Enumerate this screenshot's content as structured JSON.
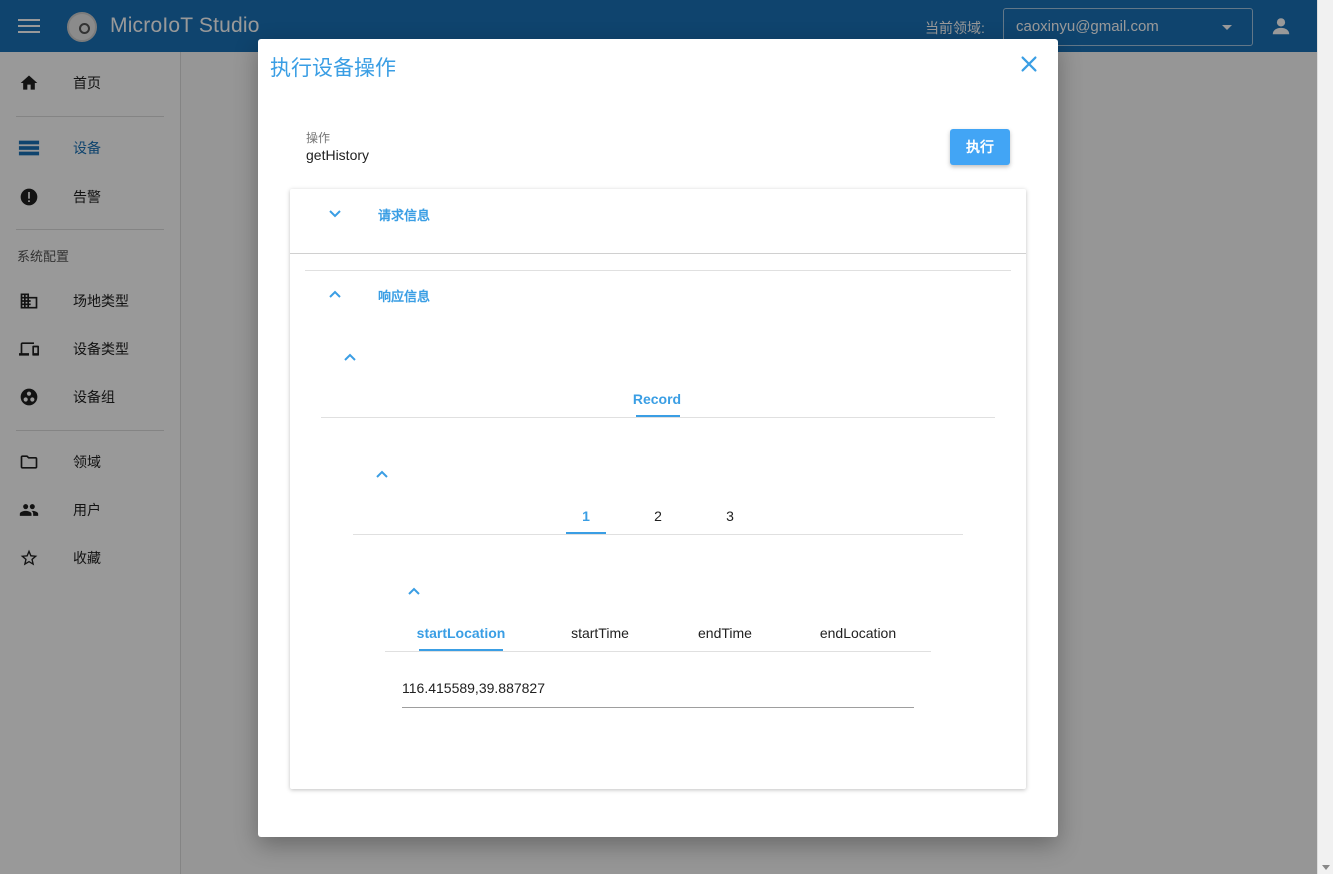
{
  "app": {
    "title": "MicroIoT Studio",
    "domain_label": "当前领域:",
    "domain_value": "caoxinyu@gmail.com"
  },
  "sidebar": {
    "items": [
      {
        "label": "首页",
        "icon": "home-icon"
      },
      {
        "label": "设备",
        "icon": "devices-icon",
        "active": true
      },
      {
        "label": "告警",
        "icon": "alert-icon"
      },
      {
        "label": "场地类型",
        "icon": "building-icon"
      },
      {
        "label": "设备类型",
        "icon": "device-type-icon"
      },
      {
        "label": "设备组",
        "icon": "group-icon"
      },
      {
        "label": "领域",
        "icon": "folder-icon"
      },
      {
        "label": "用户",
        "icon": "users-icon"
      },
      {
        "label": "收藏",
        "icon": "star-icon"
      }
    ],
    "section_title": "系统配置"
  },
  "dialog": {
    "title": "执行设备操作",
    "field_label": "操作",
    "field_value": "getHistory",
    "execute_label": "执行",
    "request_header": "请求信息",
    "response_header": "响应信息",
    "record_tab": "Record",
    "index_tabs": [
      "1",
      "2",
      "3"
    ],
    "field_tabs": [
      "startLocation",
      "startTime",
      "endTime",
      "endLocation"
    ],
    "value": "116.415589,39.887827"
  },
  "colors": {
    "appbar": "#1a72b8",
    "accent": "#3a9ee4",
    "button": "#42a5f5"
  }
}
